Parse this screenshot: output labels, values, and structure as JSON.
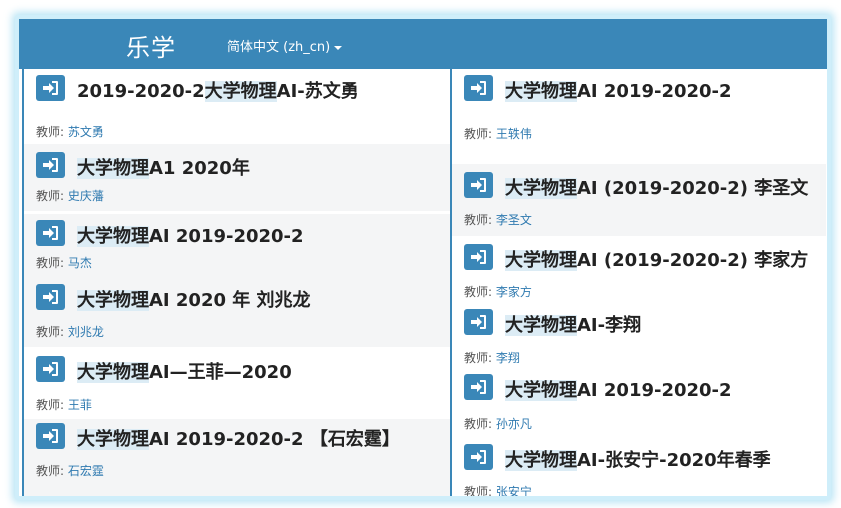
{
  "brand": "乐学",
  "language": "简体中文 (zh_cn)",
  "teacher_label": "教师:",
  "left_courses": [
    {
      "pre": "2019-2020-2",
      "hl": "大学物理",
      "rest": "AI-苏文勇",
      "teacher": "苏文勇"
    },
    {
      "pre": "",
      "hl": "大学物理",
      "rest": "A1 2020年",
      "teacher": "史庆藩"
    },
    {
      "pre": "",
      "hl": "大学物理",
      "rest": "AI 2019-2020-2",
      "teacher": "马杰"
    },
    {
      "pre": "",
      "hl": "大学物理",
      "rest": "AⅠ 2020 年 刘兆龙",
      "teacher": "刘兆龙"
    },
    {
      "pre": "",
      "hl": "大学物理",
      "rest": "AI—王菲—2020",
      "teacher": "王菲"
    },
    {
      "pre": "",
      "hl": "大学物理",
      "rest": "AⅠ 2019-2020-2 【石宏霆】",
      "teacher": "石宏霆"
    }
  ],
  "right_courses": [
    {
      "pre": "",
      "hl": "大学物理",
      "rest": "AI 2019-2020-2",
      "teacher": "王轶伟"
    },
    {
      "pre": "",
      "hl": "大学物理",
      "rest": "AI (2019-2020-2) 李圣文",
      "teacher": "李圣文"
    },
    {
      "pre": "",
      "hl": "大学物理",
      "rest": "AI (2019-2020-2) 李家方",
      "teacher": "李家方"
    },
    {
      "pre": "",
      "hl": "大学物理",
      "rest": "AⅠ-李翔",
      "teacher": "李翔"
    },
    {
      "pre": "",
      "hl": "大学物理",
      "rest": "AI 2019-2020-2",
      "teacher": "孙亦凡"
    },
    {
      "pre": "",
      "hl": "大学物理",
      "rest": "AI-张安宁-2020年春季",
      "teacher": "张安宁"
    }
  ]
}
